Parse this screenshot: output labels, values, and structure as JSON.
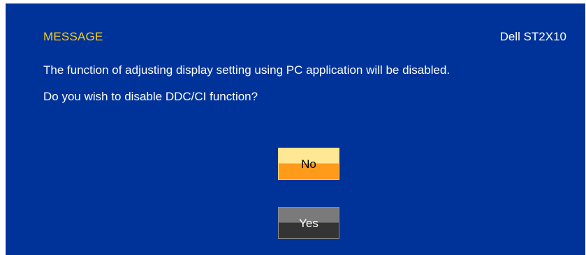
{
  "dialog": {
    "title": "MESSAGE",
    "model": "Dell ST2X10",
    "message_line1": "The function of adjusting display setting using PC application will be disabled.",
    "message_line2": "Do you wish to disable DDC/CI function?"
  },
  "buttons": {
    "no_label": "No",
    "yes_label": "Yes"
  },
  "colors": {
    "panel_background": "#003399",
    "title_text": "#f5cc19",
    "body_text": "#ffffff",
    "no_button_top": "#ffe793",
    "no_button_bottom": "#ff9a1a",
    "yes_button_top": "#7a7a7a",
    "yes_button_bottom": "#343434"
  }
}
